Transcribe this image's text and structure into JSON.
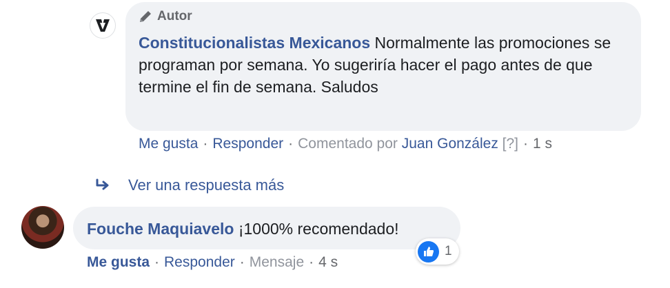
{
  "reply": {
    "author_tag": "Autor",
    "name": "Constitucionalistas Mexicanos",
    "text": "Normalmente las promociones se programan por semana. Yo sugeriría hacer el pago antes de que termine el fin de semana. Saludos",
    "actions": {
      "like": "Me gusta",
      "reply": "Responder",
      "commented_by_prefix": "Comentado por",
      "commented_by_name": "Juan González",
      "help": "[?]",
      "time": "1 s"
    }
  },
  "more_replies": {
    "label": "Ver una respuesta más"
  },
  "comment": {
    "name": "Fouche Maquiavelo",
    "text": "¡1000% recomendado!",
    "reaction_count": "1",
    "actions": {
      "like": "Me gusta",
      "reply": "Responder",
      "message": "Mensaje",
      "time": "4 s"
    }
  },
  "colors": {
    "link": "#385898",
    "bubble": "#f0f2f5",
    "like_blue": "#1877f2"
  }
}
